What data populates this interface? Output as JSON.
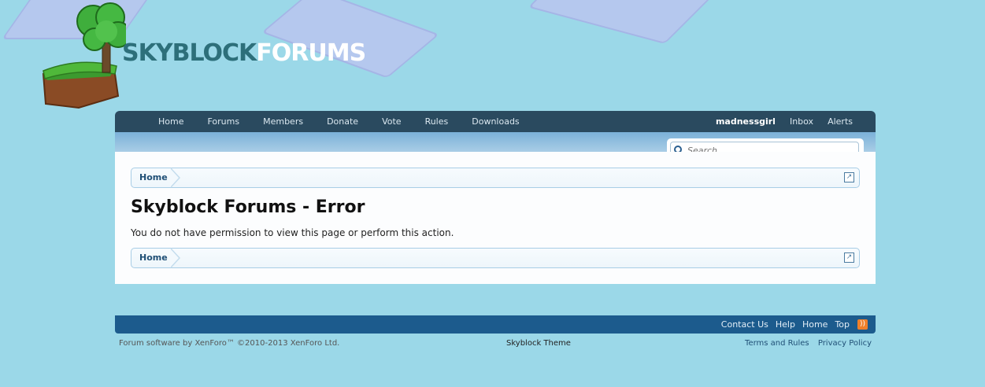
{
  "logo": {
    "text_part1": "SKYBLOCK",
    "text_part2": "FORUMS"
  },
  "nav": {
    "items": [
      "Home",
      "Forums",
      "Members",
      "Donate",
      "Vote",
      "Rules",
      "Downloads"
    ],
    "user": "madnessgirl",
    "inbox": "Inbox",
    "alerts": "Alerts"
  },
  "search": {
    "placeholder": "Search..."
  },
  "breadcrumb": {
    "home": "Home"
  },
  "page": {
    "title": "Skyblock Forums - Error",
    "message": "You do not have permission to view this page or perform this action."
  },
  "footer": {
    "links": [
      "Contact Us",
      "Help",
      "Home",
      "Top"
    ],
    "copyright": "Forum software by XenForo™ ©2010-2013 XenForo Ltd.",
    "theme": "Skyblock Theme",
    "terms": "Terms and Rules",
    "privacy": "Privacy Policy"
  },
  "colors": {
    "background": "#9bd8e8",
    "nav_bar": "#2a4a5f",
    "footer_bar": "#1c5b8d",
    "accent": "#1f4f76"
  },
  "icons": {
    "search": "magnifier-icon",
    "jump": "external-jump-icon",
    "rss": "rss-icon"
  }
}
